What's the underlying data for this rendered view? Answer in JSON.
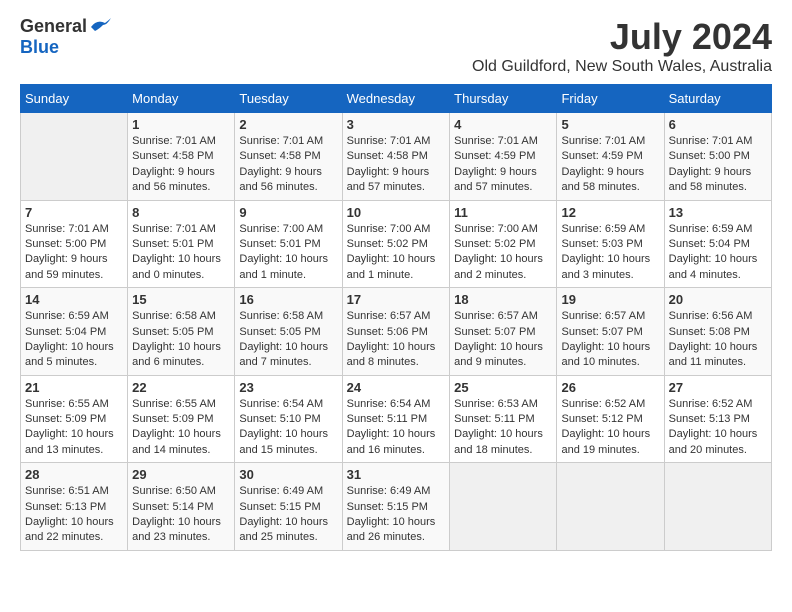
{
  "header": {
    "logo_general": "General",
    "logo_blue": "Blue",
    "month_title": "July 2024",
    "location": "Old Guildford, New South Wales, Australia"
  },
  "calendar": {
    "weekdays": [
      "Sunday",
      "Monday",
      "Tuesday",
      "Wednesday",
      "Thursday",
      "Friday",
      "Saturday"
    ],
    "weeks": [
      [
        {
          "day": "",
          "info": ""
        },
        {
          "day": "1",
          "info": "Sunrise: 7:01 AM\nSunset: 4:58 PM\nDaylight: 9 hours\nand 56 minutes."
        },
        {
          "day": "2",
          "info": "Sunrise: 7:01 AM\nSunset: 4:58 PM\nDaylight: 9 hours\nand 56 minutes."
        },
        {
          "day": "3",
          "info": "Sunrise: 7:01 AM\nSunset: 4:58 PM\nDaylight: 9 hours\nand 57 minutes."
        },
        {
          "day": "4",
          "info": "Sunrise: 7:01 AM\nSunset: 4:59 PM\nDaylight: 9 hours\nand 57 minutes."
        },
        {
          "day": "5",
          "info": "Sunrise: 7:01 AM\nSunset: 4:59 PM\nDaylight: 9 hours\nand 58 minutes."
        },
        {
          "day": "6",
          "info": "Sunrise: 7:01 AM\nSunset: 5:00 PM\nDaylight: 9 hours\nand 58 minutes."
        }
      ],
      [
        {
          "day": "7",
          "info": "Sunrise: 7:01 AM\nSunset: 5:00 PM\nDaylight: 9 hours\nand 59 minutes."
        },
        {
          "day": "8",
          "info": "Sunrise: 7:01 AM\nSunset: 5:01 PM\nDaylight: 10 hours\nand 0 minutes."
        },
        {
          "day": "9",
          "info": "Sunrise: 7:00 AM\nSunset: 5:01 PM\nDaylight: 10 hours\nand 1 minute."
        },
        {
          "day": "10",
          "info": "Sunrise: 7:00 AM\nSunset: 5:02 PM\nDaylight: 10 hours\nand 1 minute."
        },
        {
          "day": "11",
          "info": "Sunrise: 7:00 AM\nSunset: 5:02 PM\nDaylight: 10 hours\nand 2 minutes."
        },
        {
          "day": "12",
          "info": "Sunrise: 6:59 AM\nSunset: 5:03 PM\nDaylight: 10 hours\nand 3 minutes."
        },
        {
          "day": "13",
          "info": "Sunrise: 6:59 AM\nSunset: 5:04 PM\nDaylight: 10 hours\nand 4 minutes."
        }
      ],
      [
        {
          "day": "14",
          "info": "Sunrise: 6:59 AM\nSunset: 5:04 PM\nDaylight: 10 hours\nand 5 minutes."
        },
        {
          "day": "15",
          "info": "Sunrise: 6:58 AM\nSunset: 5:05 PM\nDaylight: 10 hours\nand 6 minutes."
        },
        {
          "day": "16",
          "info": "Sunrise: 6:58 AM\nSunset: 5:05 PM\nDaylight: 10 hours\nand 7 minutes."
        },
        {
          "day": "17",
          "info": "Sunrise: 6:57 AM\nSunset: 5:06 PM\nDaylight: 10 hours\nand 8 minutes."
        },
        {
          "day": "18",
          "info": "Sunrise: 6:57 AM\nSunset: 5:07 PM\nDaylight: 10 hours\nand 9 minutes."
        },
        {
          "day": "19",
          "info": "Sunrise: 6:57 AM\nSunset: 5:07 PM\nDaylight: 10 hours\nand 10 minutes."
        },
        {
          "day": "20",
          "info": "Sunrise: 6:56 AM\nSunset: 5:08 PM\nDaylight: 10 hours\nand 11 minutes."
        }
      ],
      [
        {
          "day": "21",
          "info": "Sunrise: 6:55 AM\nSunset: 5:09 PM\nDaylight: 10 hours\nand 13 minutes."
        },
        {
          "day": "22",
          "info": "Sunrise: 6:55 AM\nSunset: 5:09 PM\nDaylight: 10 hours\nand 14 minutes."
        },
        {
          "day": "23",
          "info": "Sunrise: 6:54 AM\nSunset: 5:10 PM\nDaylight: 10 hours\nand 15 minutes."
        },
        {
          "day": "24",
          "info": "Sunrise: 6:54 AM\nSunset: 5:11 PM\nDaylight: 10 hours\nand 16 minutes."
        },
        {
          "day": "25",
          "info": "Sunrise: 6:53 AM\nSunset: 5:11 PM\nDaylight: 10 hours\nand 18 minutes."
        },
        {
          "day": "26",
          "info": "Sunrise: 6:52 AM\nSunset: 5:12 PM\nDaylight: 10 hours\nand 19 minutes."
        },
        {
          "day": "27",
          "info": "Sunrise: 6:52 AM\nSunset: 5:13 PM\nDaylight: 10 hours\nand 20 minutes."
        }
      ],
      [
        {
          "day": "28",
          "info": "Sunrise: 6:51 AM\nSunset: 5:13 PM\nDaylight: 10 hours\nand 22 minutes."
        },
        {
          "day": "29",
          "info": "Sunrise: 6:50 AM\nSunset: 5:14 PM\nDaylight: 10 hours\nand 23 minutes."
        },
        {
          "day": "30",
          "info": "Sunrise: 6:49 AM\nSunset: 5:15 PM\nDaylight: 10 hours\nand 25 minutes."
        },
        {
          "day": "31",
          "info": "Sunrise: 6:49 AM\nSunset: 5:15 PM\nDaylight: 10 hours\nand 26 minutes."
        },
        {
          "day": "",
          "info": ""
        },
        {
          "day": "",
          "info": ""
        },
        {
          "day": "",
          "info": ""
        }
      ]
    ]
  }
}
